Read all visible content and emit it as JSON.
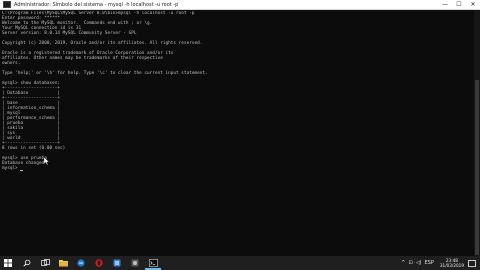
{
  "window": {
    "title": "Administrador: Símbolo del sistema - mysql  -h localhost -u root -p",
    "controls": {
      "minimize": "—",
      "maximize": "☐",
      "close": "✕"
    }
  },
  "console": {
    "lines": [
      "C:\\Program Files\\MySQL\\MySQL Server 8.0\\bin>mysql -h localhost -u root -p",
      "Enter password: ******",
      "Welcome to the MySQL monitor.  Commands end with ; or \\g.",
      "Your MySQL connection id is 31",
      "Server version: 8.0.14 MySQL Community Server - GPL",
      "",
      "Copyright (c) 2000, 2019, Oracle and/or its affiliates. All rights reserved.",
      "",
      "Oracle is a registered trademark of Oracle Corporation and/or its",
      "affiliates. Other names may be trademarks of their respective",
      "owners.",
      "",
      "Type 'help;' or '\\h' for help. Type '\\c' to clear the current input statement.",
      "",
      "mysql> show databases;",
      "+--------------------+",
      "| Database           |",
      "+--------------------+",
      "| base               |",
      "| information_schema |",
      "| mysql              |",
      "| performance_schema |",
      "| prueba             |",
      "| sakila             |",
      "| sys                |",
      "| world              |",
      "+--------------------+",
      "8 rows in set (0.00 sec)",
      "",
      "mysql> use prueba",
      "Database changed",
      "mysql> "
    ]
  },
  "taskbar": {
    "apps": [
      "start-icon",
      "search-icon",
      "task-view-icon",
      "file-explorer-icon",
      "edge-icon",
      "opera-icon",
      "app-icon",
      "app-icon",
      "command-prompt-icon"
    ],
    "tray": {
      "chevron": "^",
      "network": "⊡",
      "volume": "◁)",
      "language": "ESP"
    },
    "time": "23:48",
    "date": "31/03/2019"
  },
  "colors": {
    "console_bg": "#0c0c0c",
    "console_text": "#c0c0c0",
    "taskbar_bg": "#1f1f1f",
    "accent": "#76b9ed"
  }
}
